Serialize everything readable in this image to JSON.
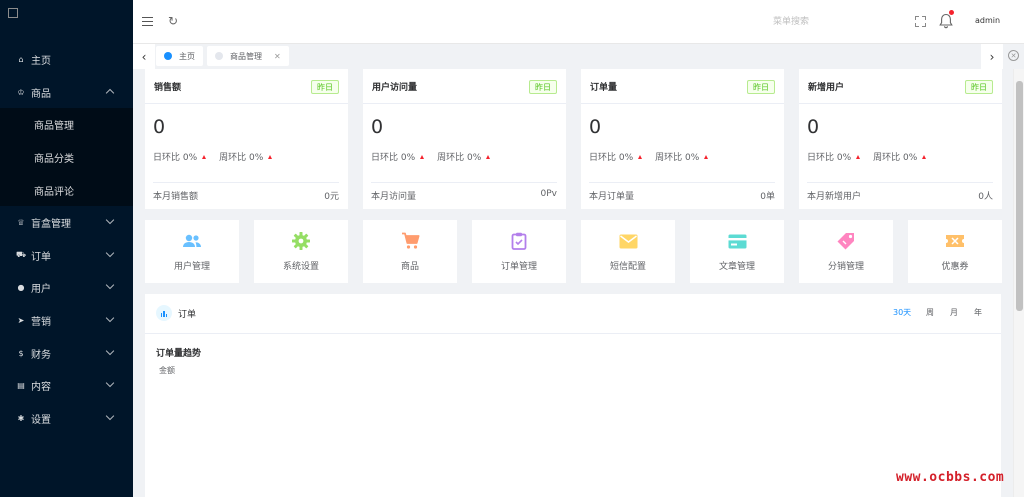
{
  "sidebar": {
    "menu": [
      {
        "label": "主页",
        "icon": "home-icon",
        "glyph": "⌂",
        "expanded": false,
        "has_children": false
      },
      {
        "label": "商品",
        "icon": "shop-icon",
        "glyph": "♔",
        "expanded": true,
        "has_children": true
      },
      {
        "label": "盲盒管理",
        "icon": "trophy-icon",
        "glyph": "♕",
        "expanded": false,
        "has_children": true
      },
      {
        "label": "订单",
        "icon": "cart-icon",
        "glyph": "⛟",
        "expanded": false,
        "has_children": true
      },
      {
        "label": "用户",
        "icon": "user-icon",
        "glyph": "●",
        "expanded": false,
        "has_children": true
      },
      {
        "label": "营销",
        "icon": "send-icon",
        "glyph": "➤",
        "expanded": false,
        "has_children": true
      },
      {
        "label": "财务",
        "icon": "dollar-icon",
        "glyph": "$",
        "expanded": false,
        "has_children": true
      },
      {
        "label": "内容",
        "icon": "book-icon",
        "glyph": "▤",
        "expanded": false,
        "has_children": true
      },
      {
        "label": "设置",
        "icon": "gear-icon",
        "glyph": "✱",
        "expanded": false,
        "has_children": true
      }
    ],
    "submenu": [
      "商品管理",
      "商品分类",
      "商品评论"
    ]
  },
  "header": {
    "search_placeholder": "菜单搜索",
    "username": "admin"
  },
  "tabs": [
    {
      "label": "主页",
      "active": true
    },
    {
      "label": "商品管理",
      "active": false
    }
  ],
  "stats": [
    {
      "title": "销售额",
      "tag": "昨日",
      "value": "0",
      "day_label": "日环比 0%",
      "week_label": "周环比 0%",
      "foot_label": "本月销售额",
      "foot_value": "0元"
    },
    {
      "title": "用户访问量",
      "tag": "昨日",
      "value": "0",
      "day_label": "日环比 0%",
      "week_label": "周环比 0%",
      "foot_label": "本月访问量",
      "foot_value": "0Pv"
    },
    {
      "title": "订单量",
      "tag": "昨日",
      "value": "0",
      "day_label": "日环比 0%",
      "week_label": "周环比 0%",
      "foot_label": "本月订单量",
      "foot_value": "0单"
    },
    {
      "title": "新增用户",
      "tag": "昨日",
      "value": "0",
      "day_label": "日环比 0%",
      "week_label": "周环比 0%",
      "foot_label": "本月新增用户",
      "foot_value": "0人"
    }
  ],
  "shortcuts": [
    {
      "label": "用户管理",
      "icon": "users-icon",
      "color": "#69c0ff"
    },
    {
      "label": "系统设置",
      "icon": "settings-icon",
      "color": "#95de64"
    },
    {
      "label": "商品",
      "icon": "shopping-cart-icon",
      "color": "#ff9c6e"
    },
    {
      "label": "订单管理",
      "icon": "clipboard-icon",
      "color": "#b37feb"
    },
    {
      "label": "短信配置",
      "icon": "mail-icon",
      "color": "#ffd666"
    },
    {
      "label": "文章管理",
      "icon": "card-icon",
      "color": "#5cdbd3"
    },
    {
      "label": "分销管理",
      "icon": "tag-icon",
      "color": "#ff85c0"
    },
    {
      "label": "优惠券",
      "icon": "coupon-icon",
      "color": "#ffc069"
    }
  ],
  "order_panel": {
    "title": "订单",
    "periods": [
      {
        "label": "30天",
        "active": true
      },
      {
        "label": "周",
        "active": false
      },
      {
        "label": "月",
        "active": false
      },
      {
        "label": "年",
        "active": false
      }
    ],
    "chart_title": "订单量趋势",
    "legend_label": "金额"
  },
  "watermark": "www.ocbbs.com",
  "colors": {
    "sidebar_bg": "#001529",
    "submenu_bg": "#000c17",
    "accent": "#1890ff",
    "tag_green": "#52c41a",
    "trend_red": "#f5222d"
  }
}
